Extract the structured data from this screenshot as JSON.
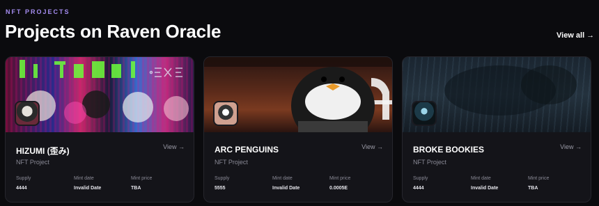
{
  "header": {
    "eyebrow": "NFT PROJECTS",
    "title": "Projects on Raven Oracle",
    "view_all": "View all",
    "view_all_arrow": "→"
  },
  "projects": [
    {
      "name": "HIZUMI (歪み)",
      "type": "NFT Project",
      "view": "View →",
      "stats": [
        {
          "label": "Supply",
          "value": "4444"
        },
        {
          "label": "Mint date",
          "value": "Invalid Date"
        },
        {
          "label": "Mint price",
          "value": "TBA"
        }
      ]
    },
    {
      "name": "ARC PENGUINS",
      "type": "NFT Project",
      "view": "View →",
      "stats": [
        {
          "label": "Supply",
          "value": "5555"
        },
        {
          "label": "Mint date",
          "value": "Invalid Date"
        },
        {
          "label": "Mint price",
          "value": "0.0005E"
        }
      ]
    },
    {
      "name": "BROKE BOOKIES",
      "type": "NFT Project",
      "view": "View →",
      "stats": [
        {
          "label": "Supply",
          "value": "4444"
        },
        {
          "label": "Mint date",
          "value": "Invalid Date"
        },
        {
          "label": "Mint price",
          "value": "TBA"
        }
      ]
    }
  ],
  "colors": {
    "accent": "#a48cf0",
    "background": "#0b0b0e",
    "card": "#141419"
  }
}
